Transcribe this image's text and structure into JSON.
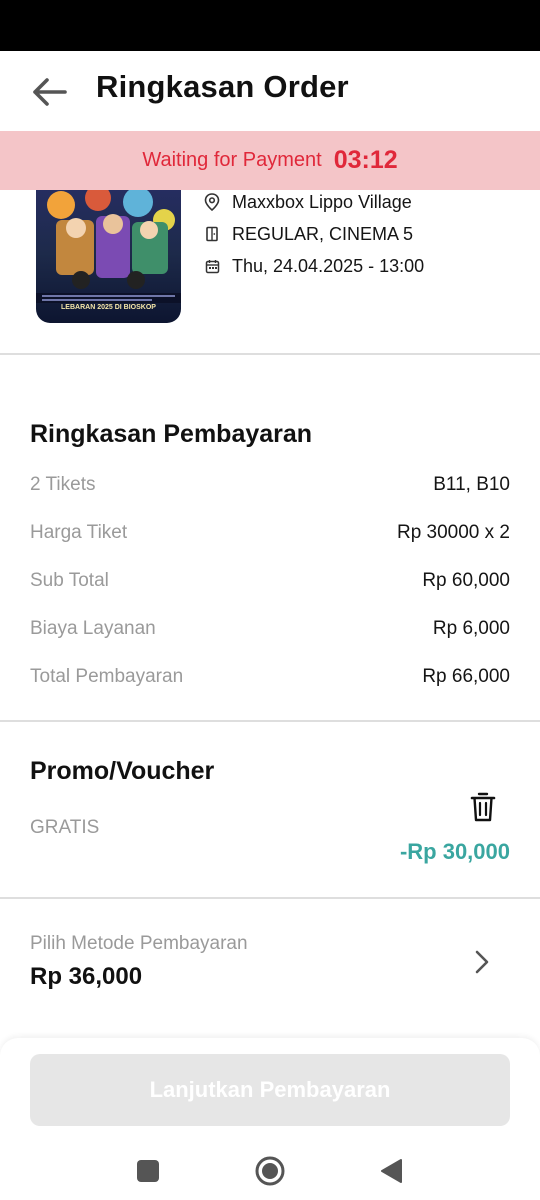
{
  "header": {
    "title": "Ringkasan Order",
    "back_icon": "arrow-left-icon"
  },
  "banner": {
    "status_text": "Waiting for Payment",
    "timer": "03:12"
  },
  "movie": {
    "poster_caption": "LEBARAN 2025 DI BIOSKOP",
    "cinema": "Maxxbox Lippo Village",
    "studio": "REGULAR, CINEMA 5",
    "datetime": "Thu, 24.04.2025 - 13:00"
  },
  "summary": {
    "title": "Ringkasan Pembayaran",
    "rows": [
      {
        "label": "2 Tikets",
        "value": "B11, B10"
      },
      {
        "label": "Harga Tiket",
        "value": "Rp 30000 x 2"
      },
      {
        "label": "Sub Total",
        "value": "Rp 60,000"
      },
      {
        "label": "Biaya Layanan",
        "value": "Rp 6,000"
      },
      {
        "label": "Total Pembayaran",
        "value": "Rp 66,000"
      }
    ]
  },
  "promo": {
    "title": "Promo/Voucher",
    "code": "GRATIS",
    "discount": "-Rp 30,000"
  },
  "payment_method": {
    "label": "Pilih Metode Pembayaran",
    "amount": "Rp 36,000"
  },
  "footer": {
    "continue_label": "Lanjutkan Pembayaran"
  },
  "colors": {
    "banner_bg": "#f4c5c8",
    "banner_text": "#e0283a",
    "discount": "#3aa6a0",
    "disabled_button": "#e6e6e6"
  }
}
